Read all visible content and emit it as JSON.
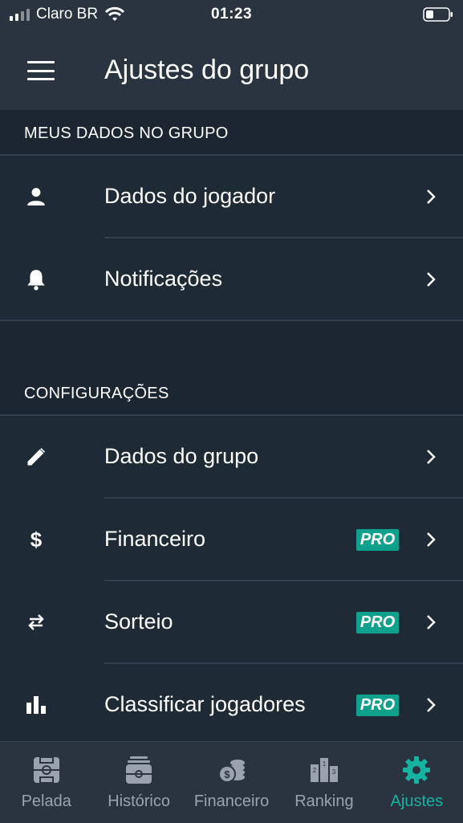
{
  "status_bar": {
    "carrier": "Claro BR",
    "time": "01:23"
  },
  "header": {
    "title": "Ajustes do grupo"
  },
  "sections": [
    {
      "title": "MEUS DADOS NO GRUPO",
      "items": [
        {
          "label": "Dados do jogador",
          "icon": "person-icon"
        },
        {
          "label": "Notificações",
          "icon": "bell-icon"
        }
      ]
    },
    {
      "title": "CONFIGURAÇÕES",
      "items": [
        {
          "label": "Dados do grupo",
          "icon": "pencil-icon"
        },
        {
          "label": "Financeiro",
          "icon": "dollar-icon",
          "badge": "PRO"
        },
        {
          "label": "Sorteio",
          "icon": "swap-icon",
          "badge": "PRO"
        },
        {
          "label": "Classificar jogadores",
          "icon": "bar-chart-icon",
          "badge": "PRO"
        }
      ]
    }
  ],
  "tabs": [
    {
      "label": "Pelada",
      "icon": "field-icon"
    },
    {
      "label": "Histórico",
      "icon": "history-field-icon"
    },
    {
      "label": "Financeiro",
      "icon": "coins-icon"
    },
    {
      "label": "Ranking",
      "icon": "podium-icon"
    },
    {
      "label": "Ajustes",
      "icon": "gear-icon",
      "active": true
    }
  ],
  "colors": {
    "accent": "#16b3a0",
    "pro_badge": "#0fa18c",
    "background": "#1c2633",
    "surface": "#2a3440"
  }
}
